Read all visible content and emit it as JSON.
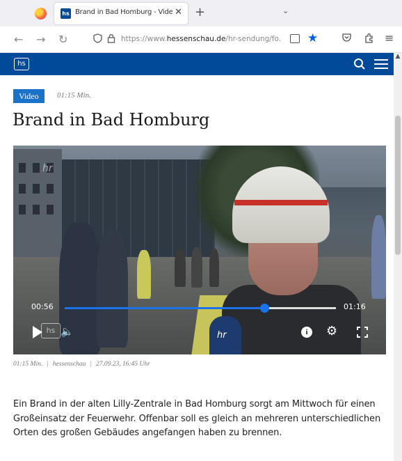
{
  "browser": {
    "tab": {
      "favicon": "hs",
      "title": "Brand in Bad Homburg - Video"
    },
    "url": {
      "prefix": "https://www.",
      "domain": "hessenschau.de",
      "path": "/hr-sendung/fo..."
    },
    "icons": {
      "close": "✕",
      "new_tab": "+",
      "tab_list": "⌄",
      "back": "←",
      "forward": "→",
      "reload": "↻",
      "shield": "🛡",
      "lock": "🔒",
      "star": "★",
      "pocket": "♡",
      "extensions": "⇪",
      "menu": "≡"
    }
  },
  "site": {
    "logo": "hs",
    "search_icon": "⌕",
    "scroll_up": "▲"
  },
  "article": {
    "badge": "Video",
    "duration": "01:15 Min.",
    "headline": "Brand in Bad Homburg",
    "meta_duration": "01:15 Min.",
    "meta_source": "hessenschau",
    "meta_date": "27.09.23, 16:45 Uhr",
    "body": "Ein Brand in der alten Lilly-Zentrale in Bad Homburg sorgt am Mittwoch für einen Großeinsatz der Feuerwehr. Offenbar soll es gleich an mehreren unterschiedlichen Orten des großen Gebäudes angefangen haben zu brennen."
  },
  "player": {
    "current_time": "00:56",
    "total_time": "01:16",
    "progress": 0.737,
    "watermark_hr": "hr",
    "mic_label": "hr",
    "hs_watermark": "hs",
    "volume_icon": "🔈",
    "info_icon": "i",
    "settings_icon": "⚙"
  },
  "colors": {
    "brand_blue": "#004a99",
    "badge_blue": "#1a73c8",
    "progress_blue": "#1a73e8"
  }
}
